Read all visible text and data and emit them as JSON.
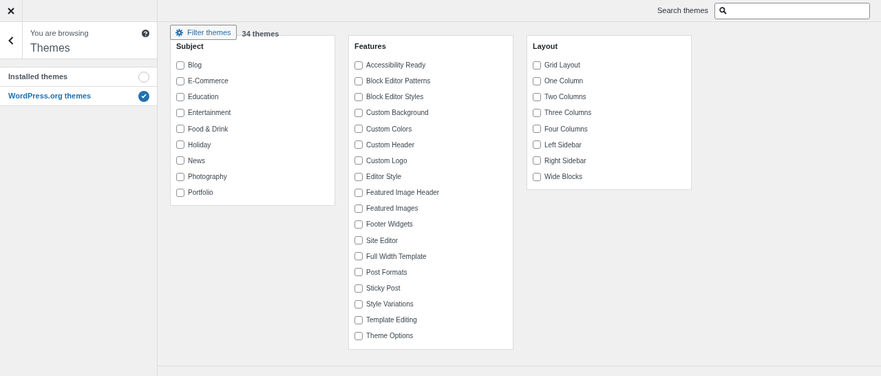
{
  "sidebar": {
    "browsing_label": "You are browsing",
    "title": "Themes",
    "sources": [
      {
        "label": "Installed themes",
        "selected": false
      },
      {
        "label": "WordPress.org themes",
        "selected": true
      }
    ]
  },
  "search": {
    "label": "Search themes"
  },
  "toolbar": {
    "filter_button": "Filter themes",
    "count": "34 themes"
  },
  "filter_groups": [
    {
      "title": "Subject",
      "options": [
        {
          "label": "Blog",
          "checked": false
        },
        {
          "label": "E-Commerce",
          "checked": false
        },
        {
          "label": "Education",
          "checked": false
        },
        {
          "label": "Entertainment",
          "checked": false
        },
        {
          "label": "Food & Drink",
          "checked": false
        },
        {
          "label": "Holiday",
          "checked": false
        },
        {
          "label": "News",
          "checked": false
        },
        {
          "label": "Photography",
          "checked": false
        },
        {
          "label": "Portfolio",
          "checked": false
        }
      ]
    },
    {
      "title": "Features",
      "options": [
        {
          "label": "Accessibility Ready",
          "checked": false
        },
        {
          "label": "Block Editor Patterns",
          "checked": false
        },
        {
          "label": "Block Editor Styles",
          "checked": false
        },
        {
          "label": "Custom Background",
          "checked": false
        },
        {
          "label": "Custom Colors",
          "checked": false
        },
        {
          "label": "Custom Header",
          "checked": false
        },
        {
          "label": "Custom Logo",
          "checked": false
        },
        {
          "label": "Editor Style",
          "checked": false
        },
        {
          "label": "Featured Image Header",
          "checked": false
        },
        {
          "label": "Featured Images",
          "checked": false
        },
        {
          "label": "Footer Widgets",
          "checked": false
        },
        {
          "label": "Site Editor",
          "checked": false
        },
        {
          "label": "Full Width Template",
          "checked": false
        },
        {
          "label": "Post Formats",
          "checked": false
        },
        {
          "label": "Sticky Post",
          "checked": false
        },
        {
          "label": "Style Variations",
          "checked": false
        },
        {
          "label": "Template Editing",
          "checked": false
        },
        {
          "label": "Theme Options",
          "checked": false
        }
      ]
    },
    {
      "title": "Layout",
      "options": [
        {
          "label": "Grid Layout",
          "checked": false
        },
        {
          "label": "One Column",
          "checked": false
        },
        {
          "label": "Two Columns",
          "checked": false
        },
        {
          "label": "Three Columns",
          "checked": false
        },
        {
          "label": "Four Columns",
          "checked": false
        },
        {
          "label": "Left Sidebar",
          "checked": false
        },
        {
          "label": "Right Sidebar",
          "checked": false
        },
        {
          "label": "Wide Blocks",
          "checked": false
        }
      ]
    }
  ]
}
